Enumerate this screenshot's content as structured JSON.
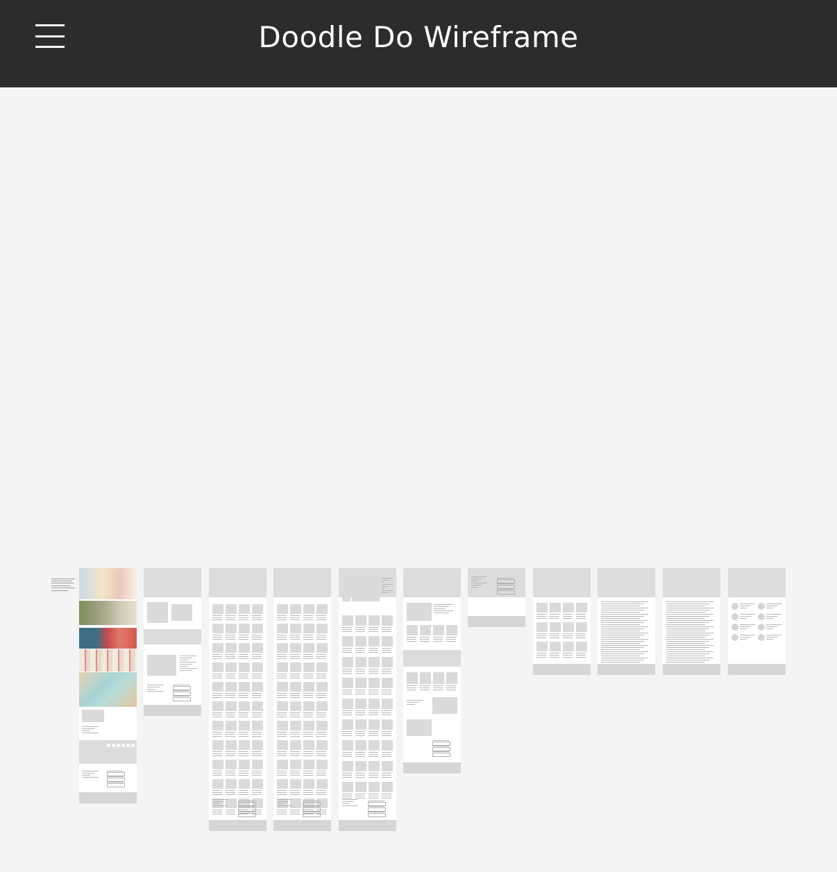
{
  "header": {
    "menu_icon": "hamburger-menu-icon",
    "title": "Doodle Do Wireframe"
  },
  "colors": {
    "header_bg": "#2c2c2c",
    "canvas_bg": "#f4f4f4",
    "frame_bg": "#ffffff",
    "placeholder_gray": "#dadada"
  }
}
